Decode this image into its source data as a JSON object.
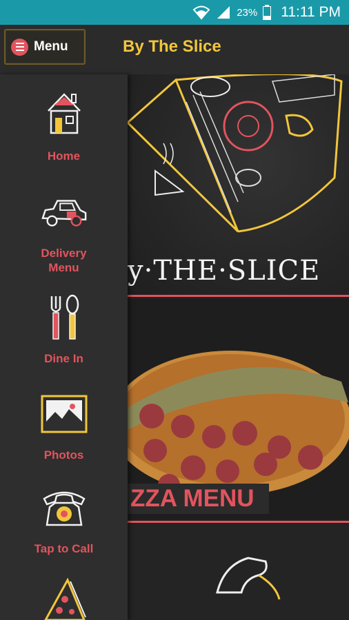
{
  "status_bar": {
    "battery_percent": "23%",
    "time": "11:11 PM",
    "icons": [
      "wifi-icon",
      "signal-icon",
      "battery-icon"
    ]
  },
  "app_bar": {
    "menu_label": "Menu",
    "title": "By The Slice"
  },
  "colors": {
    "status_bar": "#1a9aa8",
    "accent_red": "#e2545e",
    "title_yellow": "#f2c63b",
    "drawer_bg": "#2e2e2e"
  },
  "content": {
    "hero_logo": "y·THE·SLICE",
    "pizza_banner": "ZZA MENU"
  },
  "drawer": {
    "items": [
      {
        "label": "Home",
        "icon": "house-icon"
      },
      {
        "label": "Delivery\nMenu",
        "icon": "car-icon"
      },
      {
        "label": "Dine In",
        "icon": "fork-spoon-icon"
      },
      {
        "label": "Photos",
        "icon": "photo-icon"
      },
      {
        "label": "Tap to Call",
        "icon": "phone-icon"
      },
      {
        "label": "",
        "icon": "pizza-slice-icon"
      }
    ]
  }
}
